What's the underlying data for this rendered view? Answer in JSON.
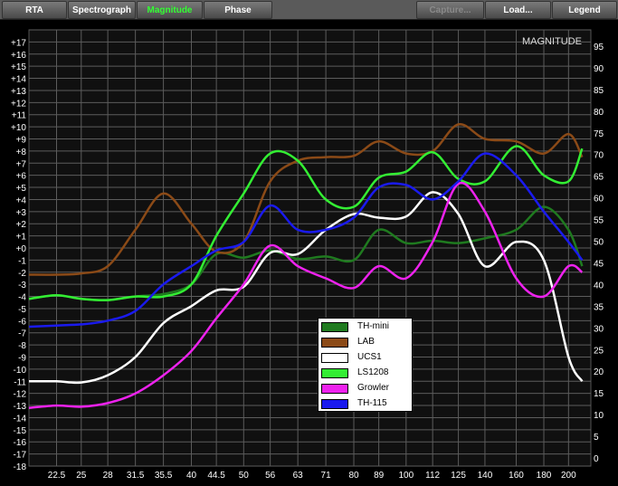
{
  "toolbar": {
    "tabs": [
      {
        "label": "RTA",
        "state": "normal"
      },
      {
        "label": "Spectrograph",
        "state": "normal"
      },
      {
        "label": "Magnitude",
        "state": "active"
      },
      {
        "label": "Phase",
        "state": "normal"
      }
    ],
    "buttons": [
      {
        "label": "Capture...",
        "state": "disabled"
      },
      {
        "label": "Load...",
        "state": "normal"
      },
      {
        "label": "Legend",
        "state": "normal"
      }
    ]
  },
  "chart_data": {
    "type": "line",
    "title": "MAGNITUDE",
    "x_ticks": [
      "22.5",
      "25",
      "28",
      "31.5",
      "35.5",
      "40",
      "44.5",
      "50",
      "56",
      "63",
      "71",
      "80",
      "89",
      "100",
      "112",
      "125",
      "140",
      "160",
      "180",
      "200"
    ],
    "x_range": [
      20,
      220
    ],
    "y_left_ticks": [
      "+17",
      "+16",
      "+15",
      "+14",
      "+13",
      "+12",
      "+11",
      "+10",
      "+9",
      "+8",
      "+7",
      "+6",
      "+5",
      "+4",
      "+3",
      "+2",
      "+1",
      "+0",
      "-1",
      "-2",
      "-3",
      "-4",
      "-5",
      "-6",
      "-7",
      "-8",
      "-9",
      "-10",
      "-11",
      "-12",
      "-13",
      "-14",
      "-15",
      "-16",
      "-17",
      "-18"
    ],
    "y_right_ticks": [
      "95",
      "90",
      "85",
      "80",
      "75",
      "70",
      "65",
      "60",
      "55",
      "50",
      "45",
      "40",
      "35",
      "30",
      "25",
      "20",
      "15",
      "10",
      "5",
      "0"
    ],
    "ylim": [
      -18,
      18
    ],
    "grid": true,
    "legend_position": "center-bottom",
    "series": [
      {
        "name": "TH-mini",
        "color": "#1f7a1f",
        "x": [
          20,
          22.5,
          25,
          28,
          31.5,
          35.5,
          40,
          44.5,
          50,
          56,
          63,
          71,
          80,
          89,
          100,
          112,
          125,
          140,
          160,
          180,
          200,
          212
        ],
        "y": [
          -4.2,
          -3.9,
          -4.2,
          -4.3,
          -4,
          -3.8,
          -3,
          -0.5,
          -0.8,
          -0.2,
          -0.9,
          -0.7,
          -1,
          1.5,
          0.4,
          0.6,
          0.4,
          0.8,
          1.5,
          3.4,
          1.5,
          -1.5
        ]
      },
      {
        "name": "LAB",
        "color": "#8b4a17",
        "x": [
          20,
          22.5,
          25,
          28,
          31.5,
          35.5,
          40,
          44.5,
          50,
          56,
          63,
          71,
          80,
          89,
          100,
          112,
          125,
          140,
          160,
          180,
          200,
          212
        ],
        "y": [
          -2.2,
          -2.2,
          -2.1,
          -1.5,
          1.5,
          4.5,
          2,
          -0.3,
          0.5,
          5.5,
          7.2,
          7.5,
          7.6,
          8.8,
          7.8,
          8,
          10.2,
          9,
          8.8,
          7.8,
          9.4,
          7.5
        ]
      },
      {
        "name": "UCS1",
        "color": "#ffffff",
        "x": [
          20,
          22.5,
          25,
          28,
          31.5,
          35.5,
          40,
          44.5,
          50,
          56,
          63,
          71,
          80,
          89,
          100,
          112,
          125,
          140,
          160,
          180,
          200,
          212
        ],
        "y": [
          -11,
          -11,
          -11.1,
          -10.5,
          -9,
          -6.2,
          -4.8,
          -3.5,
          -3.2,
          -0.4,
          -0.5,
          1.5,
          2.8,
          2.5,
          2.6,
          4.6,
          2.8,
          -1.5,
          0.5,
          -1,
          -9,
          -11
        ]
      },
      {
        "name": "LS1208",
        "color": "#33ee33",
        "x": [
          20,
          22.5,
          25,
          28,
          31.5,
          35.5,
          40,
          44.5,
          50,
          56,
          63,
          71,
          80,
          89,
          100,
          112,
          125,
          140,
          160,
          180,
          200,
          212
        ],
        "y": [
          -4.2,
          -3.9,
          -4.2,
          -4.3,
          -4,
          -4,
          -3,
          1,
          4.5,
          7.8,
          7.2,
          4,
          3.4,
          5.8,
          6.3,
          7.9,
          5.7,
          5.5,
          8.4,
          6,
          5.5,
          8.2
        ]
      },
      {
        "name": "Growler",
        "color": "#ee22ee",
        "x": [
          20,
          22.5,
          25,
          28,
          31.5,
          35.5,
          40,
          44.5,
          50,
          56,
          63,
          71,
          80,
          89,
          100,
          112,
          125,
          140,
          160,
          180,
          200,
          212
        ],
        "y": [
          -13.2,
          -13,
          -13.1,
          -12.8,
          -12,
          -10.5,
          -8.5,
          -5.8,
          -3,
          0.2,
          -1.5,
          -2.5,
          -3.3,
          -1.5,
          -2.5,
          0.5,
          5.3,
          3,
          -2.5,
          -4,
          -1.5,
          -2
        ]
      },
      {
        "name": "TH-115",
        "color": "#1a1aee",
        "x": [
          20,
          22.5,
          25,
          28,
          31.5,
          35.5,
          40,
          44.5,
          50,
          56,
          63,
          71,
          80,
          89,
          100,
          112,
          125,
          140,
          160,
          180,
          200,
          212
        ],
        "y": [
          -6.5,
          -6.4,
          -6.3,
          -6,
          -5.2,
          -3,
          -1.5,
          -0.2,
          0.5,
          3.5,
          1.5,
          1.5,
          2.5,
          5,
          5.2,
          4,
          5.5,
          7.8,
          6,
          3,
          0.5,
          -1
        ]
      }
    ]
  }
}
